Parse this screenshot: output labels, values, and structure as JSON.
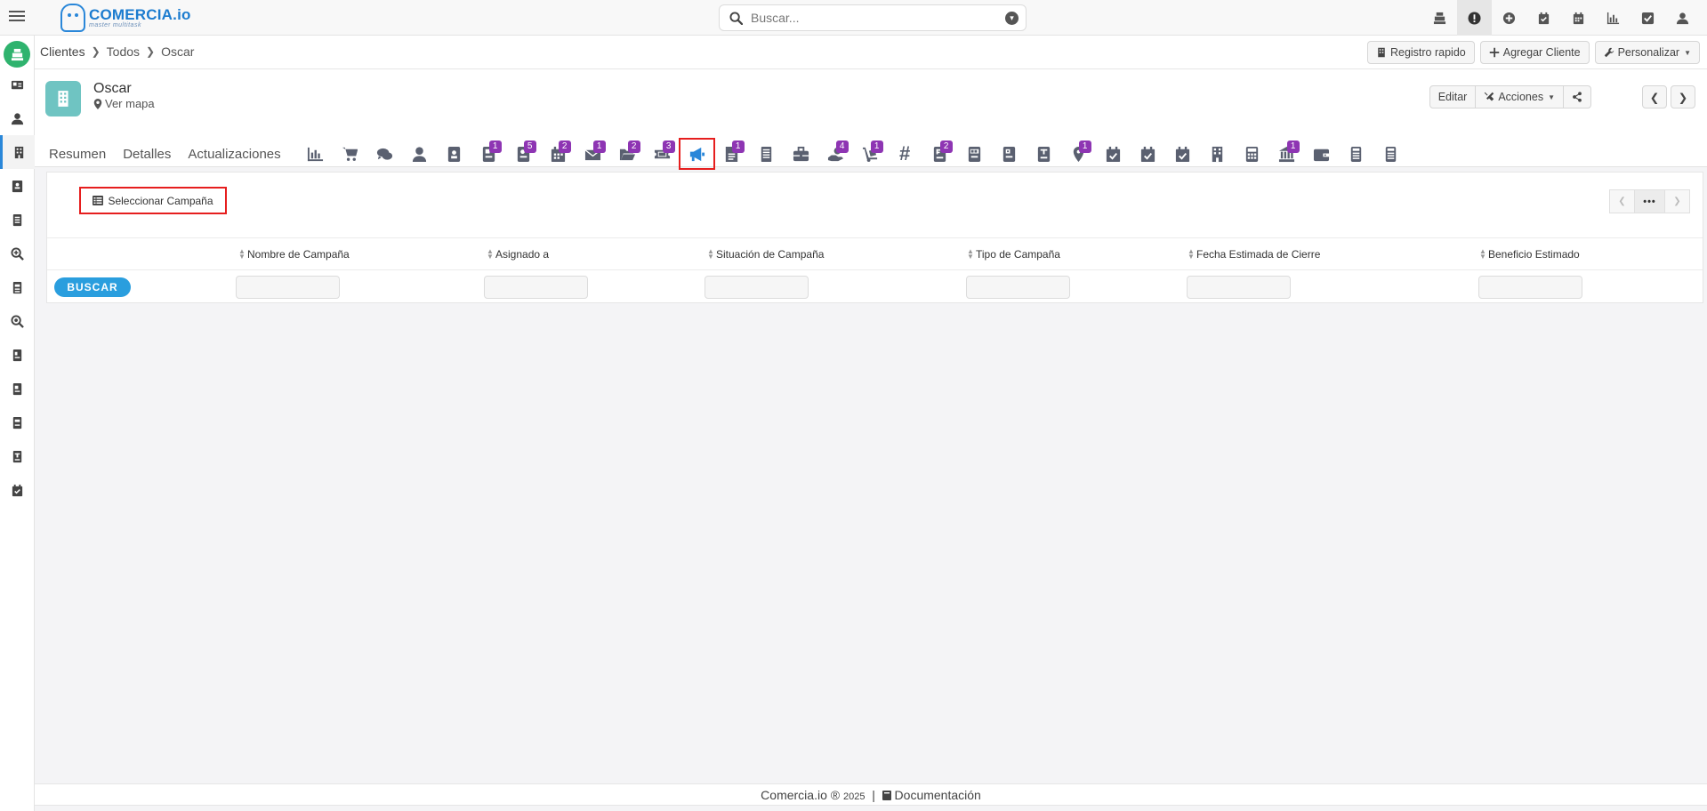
{
  "app": {
    "logo_name": "COMERCIA.io",
    "logo_tagline": "master multitask"
  },
  "search": {
    "placeholder": "Buscar..."
  },
  "top_icons": [
    "cash-register-icon",
    "alert-icon",
    "plus-circle-icon",
    "calendar-check-icon",
    "calendar-icon",
    "bar-chart-icon",
    "checkbox-icon",
    "user-icon"
  ],
  "breadcrumb": {
    "items": [
      "Clientes",
      "Todos",
      "Oscar"
    ]
  },
  "toolbar": {
    "registro_rapido": "Registro rapido",
    "agregar_cliente": "Agregar Cliente",
    "personalizar": "Personalizar"
  },
  "record": {
    "name": "Oscar",
    "map_link": "Ver mapa",
    "edit_label": "Editar",
    "actions_label": "Acciones"
  },
  "tabs": {
    "resumen": "Resumen",
    "detalles": "Detalles",
    "actualizaciones": "Actualizaciones"
  },
  "modules": [
    {
      "name": "chart-icon",
      "badge": ""
    },
    {
      "name": "cart-icon",
      "badge": ""
    },
    {
      "name": "chat-icon",
      "badge": ""
    },
    {
      "name": "person-icon",
      "badge": ""
    },
    {
      "name": "contacts-icon",
      "badge": ""
    },
    {
      "name": "quote-c-icon",
      "badge": "1"
    },
    {
      "name": "order-o-icon",
      "badge": "5"
    },
    {
      "name": "calendar-grid-icon",
      "badge": "2"
    },
    {
      "name": "email-icon",
      "badge": "1"
    },
    {
      "name": "folder-icon",
      "badge": "2"
    },
    {
      "name": "ticket-icon",
      "badge": "3"
    },
    {
      "name": "megaphone-icon",
      "badge": ""
    },
    {
      "name": "document-icon",
      "badge": "1"
    },
    {
      "name": "ledger-icon",
      "badge": ""
    },
    {
      "name": "briefcase-icon",
      "badge": ""
    },
    {
      "name": "hand-money-icon",
      "badge": "4"
    },
    {
      "name": "dolly-icon",
      "badge": "1"
    },
    {
      "name": "hashtag-icon",
      "badge": ""
    },
    {
      "name": "invoice-f-icon",
      "badge": "2"
    },
    {
      "name": "credit-note-icon",
      "badge": ""
    },
    {
      "name": "p-doc-icon",
      "badge": ""
    },
    {
      "name": "t-doc-icon",
      "badge": ""
    },
    {
      "name": "map-pin-icon",
      "badge": "1"
    },
    {
      "name": "calendar-check-1-icon",
      "badge": ""
    },
    {
      "name": "calendar-check-2-icon",
      "badge": ""
    },
    {
      "name": "calendar-check-3-icon",
      "badge": ""
    },
    {
      "name": "building-icon",
      "badge": ""
    },
    {
      "name": "calculator-icon",
      "badge": ""
    },
    {
      "name": "bank-icon",
      "badge": "1"
    },
    {
      "name": "wallet-icon",
      "badge": ""
    },
    {
      "name": "register-1-icon",
      "badge": ""
    },
    {
      "name": "register-2-icon",
      "badge": ""
    }
  ],
  "campaign_panel": {
    "select_label": "Seleccionar Campaña",
    "buscar_label": "BUSCAR",
    "columns": [
      "Nombre de Campaña",
      "Asignado a",
      "Situación de Campaña",
      "Tipo de Campaña",
      "Fecha Estimada de Cierre",
      "Beneficio Estimado"
    ]
  },
  "footer": {
    "brand": "Comercia.io ®",
    "year": "2025",
    "divider": "|",
    "docs_label": "Documentación"
  },
  "colors": {
    "brand_blue": "#1c7ccf",
    "badge_purple": "#8e35b3",
    "highlight_red": "#e61e1e",
    "home_green": "#2fb36e",
    "avatar_teal": "#6fc4c2",
    "buscar_blue": "#2a9ede"
  }
}
